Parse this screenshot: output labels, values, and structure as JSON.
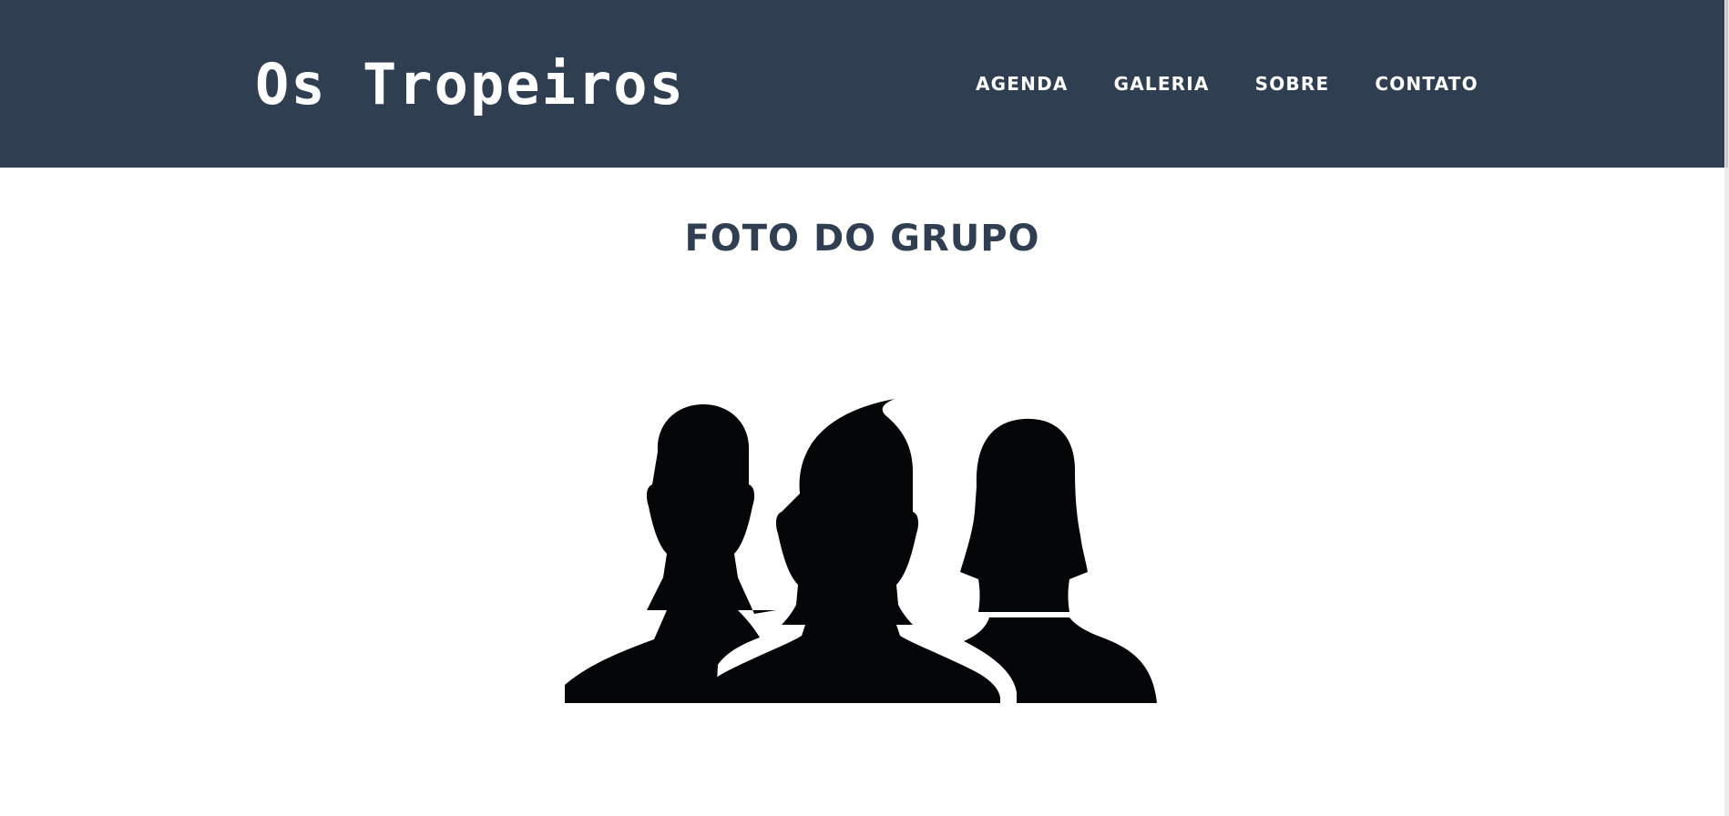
{
  "brand": {
    "logo_text": "Os Tropeiros"
  },
  "nav": {
    "items": [
      {
        "label": "AGENDA"
      },
      {
        "label": "GALERIA"
      },
      {
        "label": "SOBRE"
      },
      {
        "label": "CONTATO"
      }
    ]
  },
  "main": {
    "section_title": "FOTO DO GRUPO",
    "image": {
      "icon": "group-silhouette-icon"
    }
  },
  "colors": {
    "header_bg": "#2f3f51",
    "title": "#2f3f51",
    "nav_text": "#ffffff",
    "silhouette": "#050608"
  }
}
